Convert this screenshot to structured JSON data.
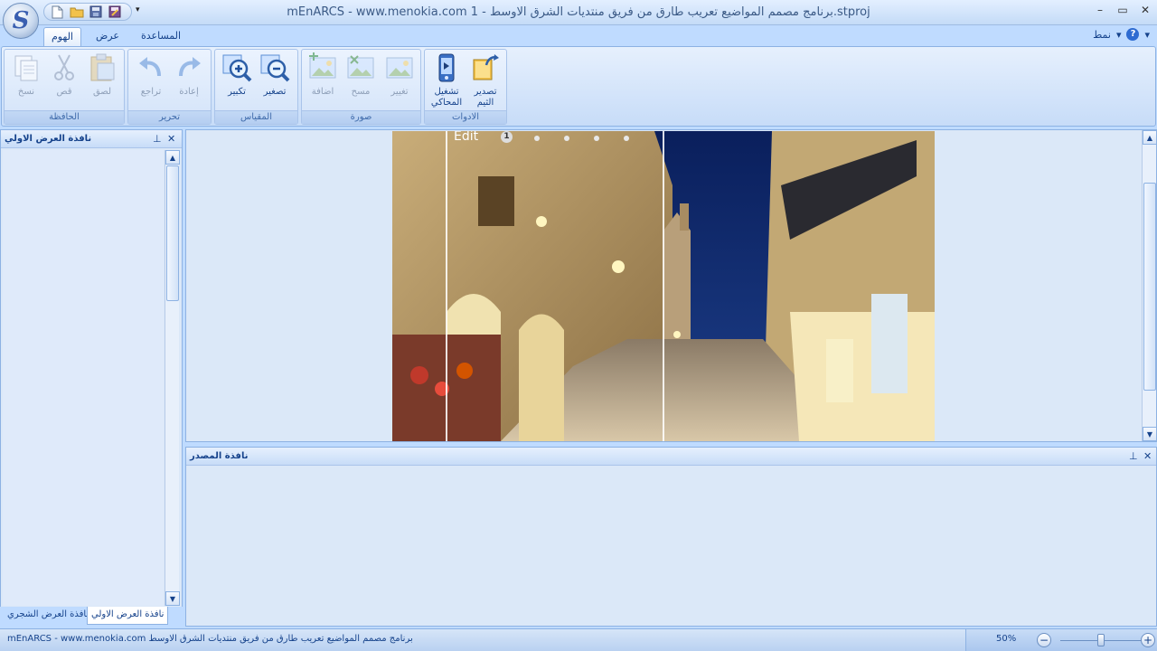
{
  "window": {
    "title": "mEnARCS - www.menokia.com برنامج مصمم المواضيع تعريب طارق من فريق منتديات الشرق الاوسط - 1.stproj",
    "controls": {
      "minimize": "–",
      "maximize": "▭",
      "close": "✕"
    }
  },
  "qat": {
    "dropdown": "▾"
  },
  "tabs": [
    {
      "label": "الهوم"
    },
    {
      "label": "عرض"
    },
    {
      "label": "المساعدة"
    }
  ],
  "style_menu": {
    "label": "نمط",
    "arrow": "▾",
    "help": "?"
  },
  "ribbon": {
    "clipboard": {
      "label": "الحافظة",
      "copy": "نسخ",
      "cut": "قص",
      "paste": "لصق"
    },
    "edit": {
      "label": "تحرير",
      "undo": "تراجع",
      "redo": "إعادة"
    },
    "scale": {
      "label": "المقياس",
      "zoom_in": "تكبير",
      "zoom_out": "تصغير"
    },
    "image": {
      "label": "صورة",
      "add": "اضافة",
      "clear": "مسح",
      "change": "تغيير"
    },
    "tools": {
      "label": "الادوات",
      "run_emulator_l1": "تشغيل",
      "run_emulator_l2": "المحاكي",
      "export_theme_l1": "تصدير",
      "export_theme_l2": "الثيم"
    }
  },
  "left_panel": {
    "title": "نافذة العرض الاولي",
    "pin": "⊥",
    "close": "✕"
  },
  "bottom_tabs": {
    "tree": "نافذة العرض الشجري",
    "preview": "نافذة العرض الاولي"
  },
  "preview": {
    "edit_label": "Edit",
    "step_number": "1"
  },
  "source_panel": {
    "title": "نافذة المصدر",
    "pin": "⊥",
    "close": "✕"
  },
  "status": {
    "text": "mEnARCS - www.menokia.com برنامج مصمم المواضيع تعريب طارق من فريق منتديات الشرق الاوسط",
    "zoom": "50%",
    "zoom_minus": "−",
    "zoom_plus": "+",
    "zoom_fraction": 0.5
  },
  "colors": {
    "ribbon_text": "#15428b",
    "accent": "#2e6bd1"
  }
}
